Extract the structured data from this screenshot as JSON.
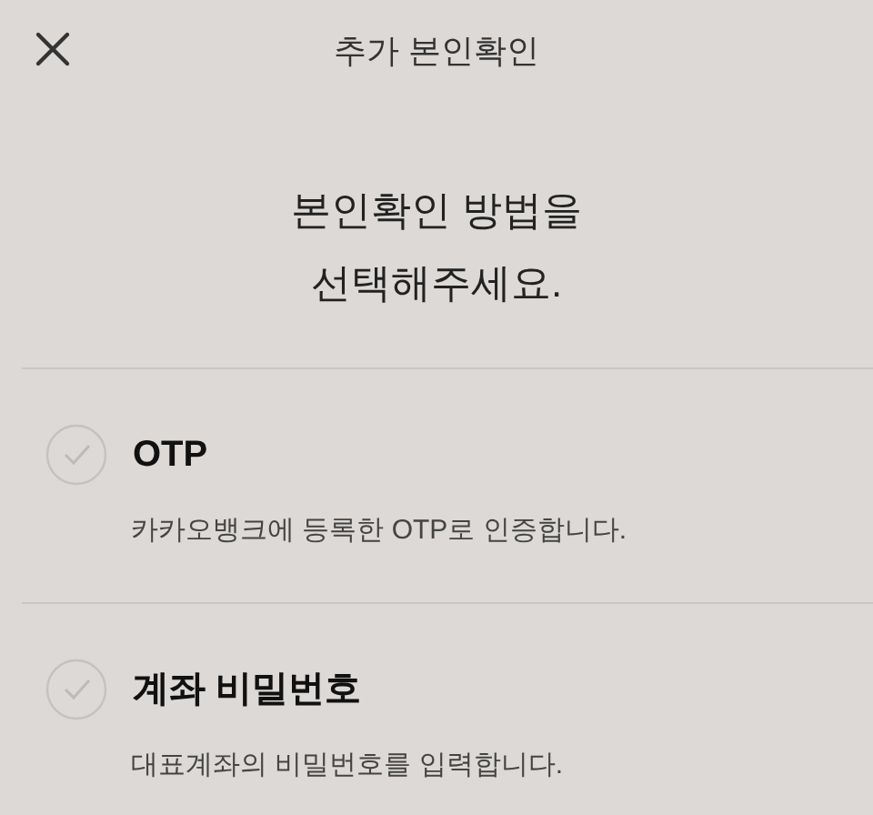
{
  "header": {
    "title": "추가 본인확인"
  },
  "heading": [
    "본인확인 방법을",
    "선택해주세요."
  ],
  "options": [
    {
      "title": "OTP",
      "description": "카카오뱅크에 등록한 OTP로 인증합니다.",
      "selected": false
    },
    {
      "title": "계좌 비밀번호",
      "description": "대표계좌의 비밀번호를 입력합니다.",
      "selected": false
    }
  ]
}
